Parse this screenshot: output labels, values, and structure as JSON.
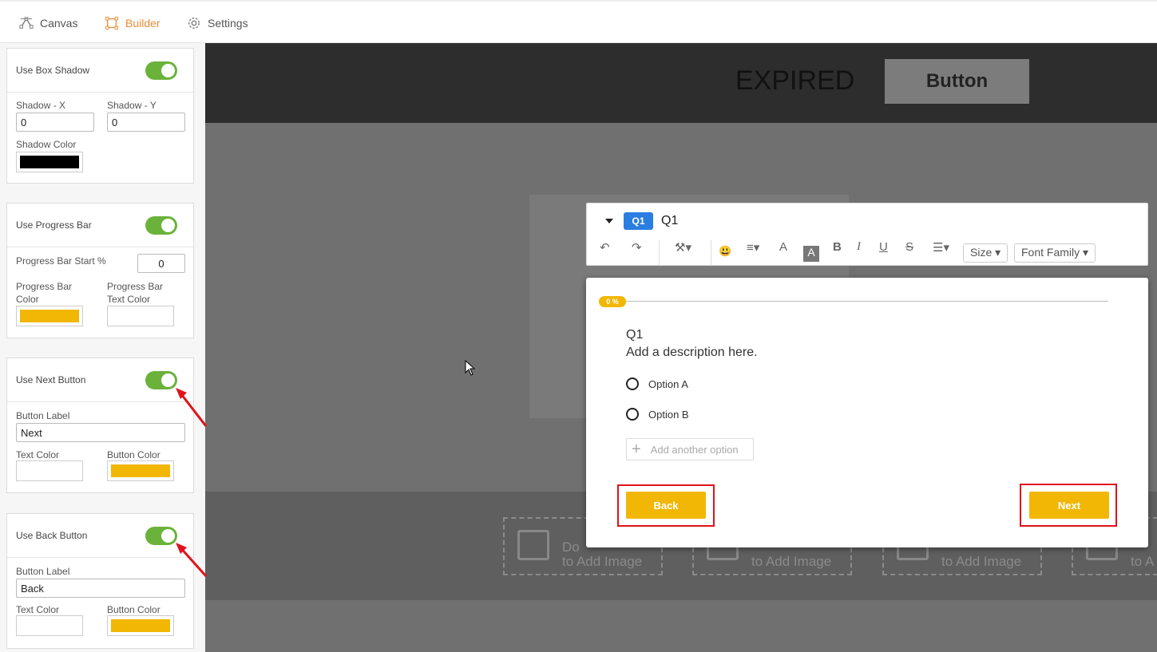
{
  "nav": {
    "canvas": "Canvas",
    "builder": "Builder",
    "settings": "Settings"
  },
  "sidebar": {
    "box_shadow": {
      "toggle_label": "Use Box Shadow",
      "enabled": true,
      "shadow_x_label": "Shadow - X",
      "shadow_x_value": "0",
      "shadow_y_label": "Shadow - Y",
      "shadow_y_value": "0",
      "shadow_color_label": "Shadow Color",
      "shadow_color": "#000000"
    },
    "progress_bar": {
      "toggle_label": "Use Progress Bar",
      "enabled": true,
      "start_label": "Progress Bar Start %",
      "start_value": "0",
      "color_label": "Progress Bar Color",
      "color": "#f2b705",
      "text_color_label": "Progress Bar Text Color",
      "text_color": "#ffffff"
    },
    "next_button": {
      "toggle_label": "Use Next Button",
      "enabled": true,
      "button_label_label": "Button Label",
      "button_label_value": "Next",
      "text_color_label": "Text Color",
      "text_color": "#ffffff",
      "button_color_label": "Button Color",
      "button_color": "#f2b705"
    },
    "back_button": {
      "toggle_label": "Use Back Button",
      "enabled": true,
      "button_label_label": "Button Label",
      "button_label_value": "Back",
      "text_color_label": "Text Color",
      "text_color": "#ffffff",
      "button_color_label": "Button Color",
      "button_color": "#f2b705"
    }
  },
  "canvas": {
    "expired_text": "EXPIRED",
    "button_text": "Button",
    "image_drop_texts": [
      "Do",
      "to Add Image",
      "to Add Image",
      "to Add Image",
      "to A"
    ]
  },
  "editor": {
    "badge": "Q1",
    "title": "Q1",
    "size_dropdown": "Size",
    "font_family_dropdown": "Font Family"
  },
  "quiz": {
    "progress_text": "0 %",
    "question": "Q1",
    "description": "Add a description here.",
    "options": [
      "Option A",
      "Option B"
    ],
    "add_option": "Add another option",
    "back_label": "Back",
    "next_label": "Next"
  },
  "colors": {
    "accent": "#e98b36",
    "toggle_on": "#6bb23b",
    "quiz_yellow": "#f2b705",
    "badge_blue": "#2a7de1",
    "highlight_red": "#e0131b"
  }
}
